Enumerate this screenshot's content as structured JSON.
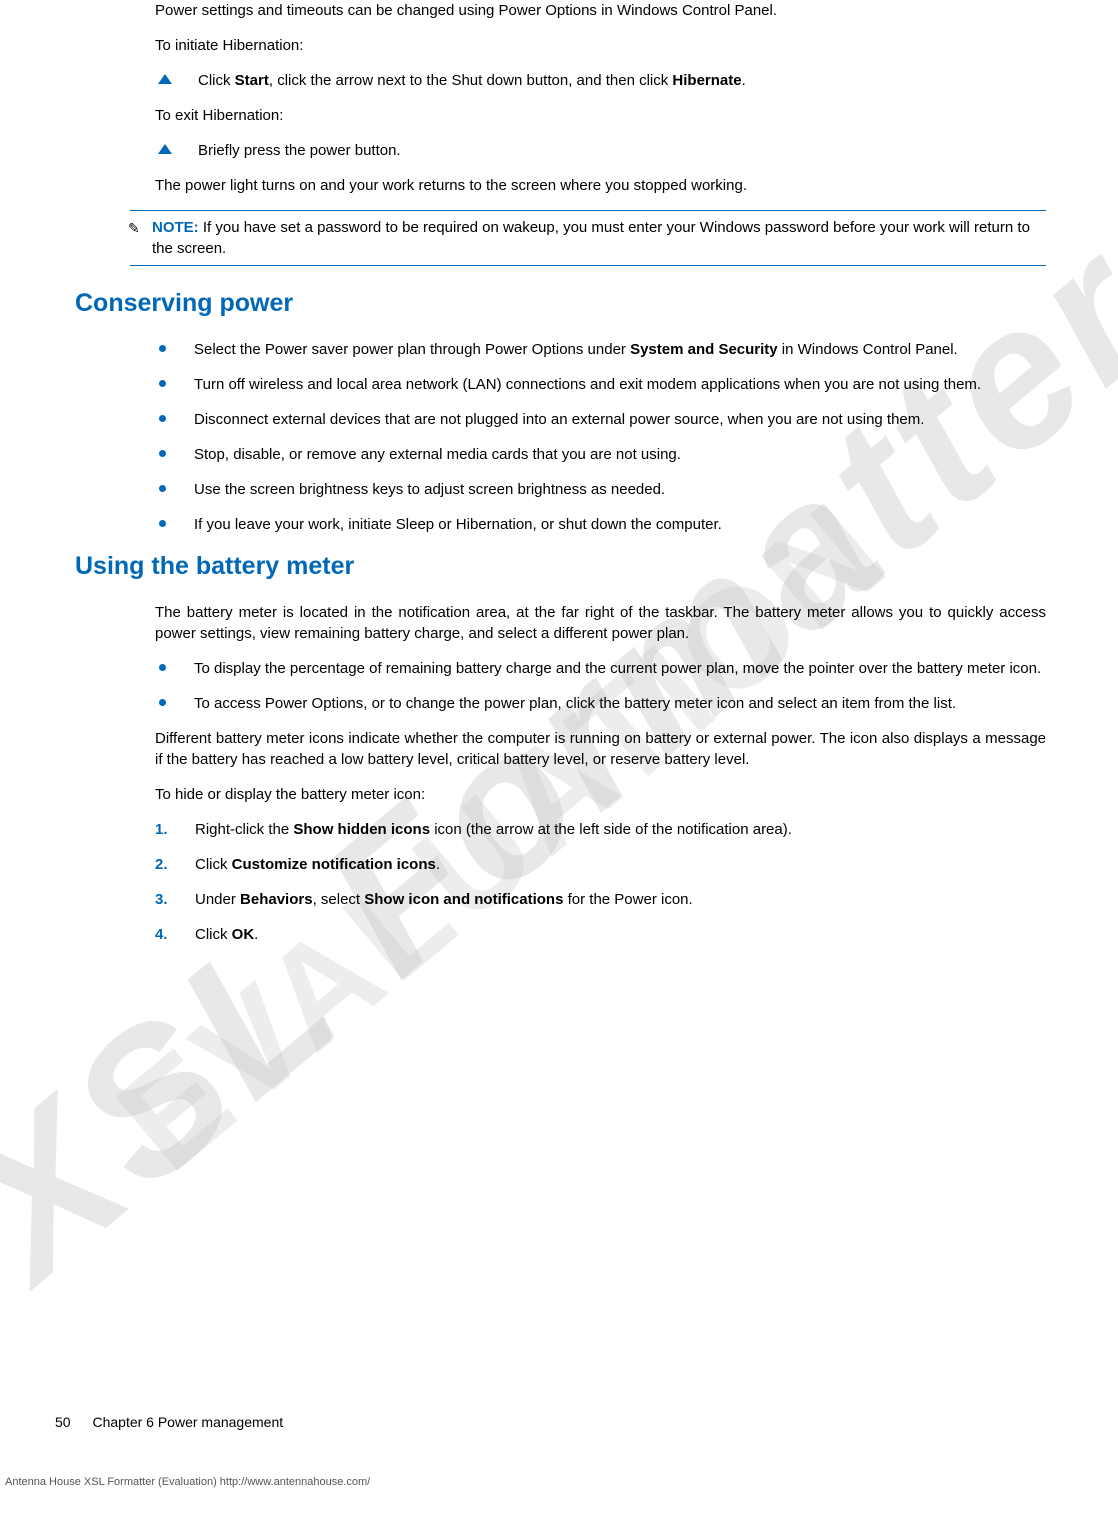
{
  "watermark_main": "XSL Formatter",
  "watermark_sub": "EVALUATION",
  "intro": {
    "p1": "Power settings and timeouts can be changed using Power Options in Windows Control Panel.",
    "p2": "To initiate Hibernation:",
    "step1_pre": "Click ",
    "step1_b1": "Start",
    "step1_mid": ", click the arrow next to the Shut down button, and then click ",
    "step1_b2": "Hibernate",
    "step1_post": ".",
    "p3": "To exit Hibernation:",
    "step2": "Briefly press the power button.",
    "p4": "The power light turns on and your work returns to the screen where you stopped working."
  },
  "note": {
    "label": "NOTE:",
    "text": "If you have set a password to be required on wakeup, you must enter your Windows password before your work will return to the screen."
  },
  "section1": {
    "title": "Conserving power",
    "items": [
      {
        "pre": "Select the Power saver power plan through Power Options under ",
        "b": "System and Security",
        "post": " in Windows Control Panel."
      },
      {
        "pre": "Turn off wireless and local area network (LAN) connections and exit modem applications when you are not using them.",
        "b": "",
        "post": ""
      },
      {
        "pre": "Disconnect external devices that are not plugged into an external power source, when you are not using them.",
        "b": "",
        "post": ""
      },
      {
        "pre": "Stop, disable, or remove any external media cards that you are not using.",
        "b": "",
        "post": ""
      },
      {
        "pre": "Use the screen brightness keys to adjust screen brightness as needed.",
        "b": "",
        "post": ""
      },
      {
        "pre": "If you leave your work, initiate Sleep or Hibernation, or shut down the computer.",
        "b": "",
        "post": ""
      }
    ]
  },
  "section2": {
    "title": "Using the battery meter",
    "p1": "The battery meter is located in the notification area, at the far right of the taskbar. The battery meter allows you to quickly access power settings, view remaining battery charge, and select a different power plan.",
    "bullets": [
      "To display the percentage of remaining battery charge and the current power plan, move the pointer over the battery meter icon.",
      "To access Power Options, or to change the power plan, click the battery meter icon and select an item from the list."
    ],
    "p2": "Different battery meter icons indicate whether the computer is running on battery or external power. The icon also displays a message if the battery has reached a low battery level, critical battery level, or reserve battery level.",
    "p3": "To hide or display the battery meter icon:",
    "steps": [
      {
        "n": "1.",
        "pre": "Right-click the ",
        "b": "Show hidden icons",
        "post": " icon (the arrow at the left side of the notification area)."
      },
      {
        "n": "2.",
        "pre": "Click ",
        "b": "Customize notification icons",
        "post": "."
      },
      {
        "n": "3.",
        "pre": "Under ",
        "b": "Behaviors",
        "mid": ", select ",
        "b2": "Show icon and notifications",
        "post": " for the Power icon."
      },
      {
        "n": "4.",
        "pre": "Click ",
        "b": "OK",
        "post": "."
      }
    ]
  },
  "footer": {
    "page": "50",
    "chapter": "Chapter 6   Power management"
  },
  "credit": "Antenna House XSL Formatter (Evaluation)  http://www.antennahouse.com/"
}
